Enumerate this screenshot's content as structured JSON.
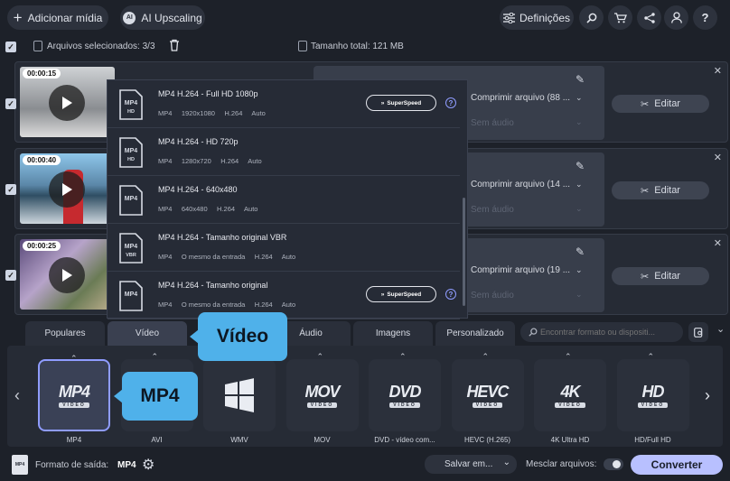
{
  "toolbar": {
    "add_media": "Adicionar mídia",
    "ai_upscaling": "AI Upscaling",
    "settings": "Definições"
  },
  "selection": {
    "label": "Arquivos selecionados: 3/3",
    "total_size": "Tamanho total: 121 MB"
  },
  "files": [
    {
      "duration": "00:00:15",
      "compress": "Comprimir arquivo (88 ...",
      "no_audio": "Sem áudio",
      "title": "Sem legendas..."
    },
    {
      "duration": "00:00:40",
      "compress": "Comprimir arquivo (14 ...",
      "no_audio": "Sem áudio",
      "title": ""
    },
    {
      "duration": "00:00:25",
      "compress": "Comprimir arquivo (19 ...",
      "no_audio": "Sem áudio",
      "title": ""
    }
  ],
  "edit_label": "Editar",
  "dropdown": [
    {
      "icon_top": "MP4",
      "icon_bottom": "HD",
      "name": "MP4 H.264 - Full HD 1080p",
      "meta": "MP4     1920x1080     H.264     Auto",
      "superspeed": true
    },
    {
      "icon_top": "MP4",
      "icon_bottom": "HD",
      "name": "MP4 H.264 - HD 720p",
      "meta": "MP4     1280x720     H.264     Auto",
      "superspeed": false
    },
    {
      "icon_top": "MP4",
      "icon_bottom": "",
      "name": "MP4 H.264 - 640x480",
      "meta": "MP4     640x480     H.264     Auto",
      "superspeed": false
    },
    {
      "icon_top": "MP4",
      "icon_bottom": "VBR",
      "name": "MP4 H.264 - Tamanho original VBR",
      "meta": "MP4     O mesmo da entrada     H.264     Auto",
      "superspeed": false
    },
    {
      "icon_top": "MP4",
      "icon_bottom": "",
      "name": "MP4 H.264 - Tamanho original",
      "meta": "MP4     O mesmo da entrada     H.264     Auto",
      "superspeed": true
    }
  ],
  "superspeed_label": "SuperSpeed",
  "tabs": {
    "popular": "Populares",
    "video": "Vídeo",
    "audio": "Áudio",
    "images": "Imagens",
    "custom": "Personalizado"
  },
  "search": {
    "placeholder": "Encontrar formato ou dispositi..."
  },
  "formats": [
    {
      "logo": "MP4",
      "sub": "VIDEO",
      "label": "MP4"
    },
    {
      "logo": "AVI",
      "sub": "",
      "label": "AVI"
    },
    {
      "logo": "WMV",
      "sub": "",
      "label": "WMV"
    },
    {
      "logo": "MOV",
      "sub": "VIDEO",
      "label": "MOV"
    },
    {
      "logo": "DVD",
      "sub": "VIDEO",
      "label": "DVD - vídeo com..."
    },
    {
      "logo": "HEVC",
      "sub": "VIDEO",
      "label": "HEVC (H.265)"
    },
    {
      "logo": "4K",
      "sub": "VIDEO",
      "label": "4K Ultra HD"
    },
    {
      "logo": "HD",
      "sub": "VIDEO",
      "label": "HD/Full HD"
    }
  ],
  "callouts": {
    "video": "Vídeo",
    "mp4": "MP4"
  },
  "footer": {
    "output_format_label": "Formato de saída:",
    "output_format_value": "MP4",
    "save_to": "Salvar em...",
    "merge": "Mesclar arquivos:",
    "convert": "Converter"
  },
  "colors": {
    "accent": "#b8c0ff",
    "callout": "#4fb1ea",
    "background": "#1d2129"
  }
}
